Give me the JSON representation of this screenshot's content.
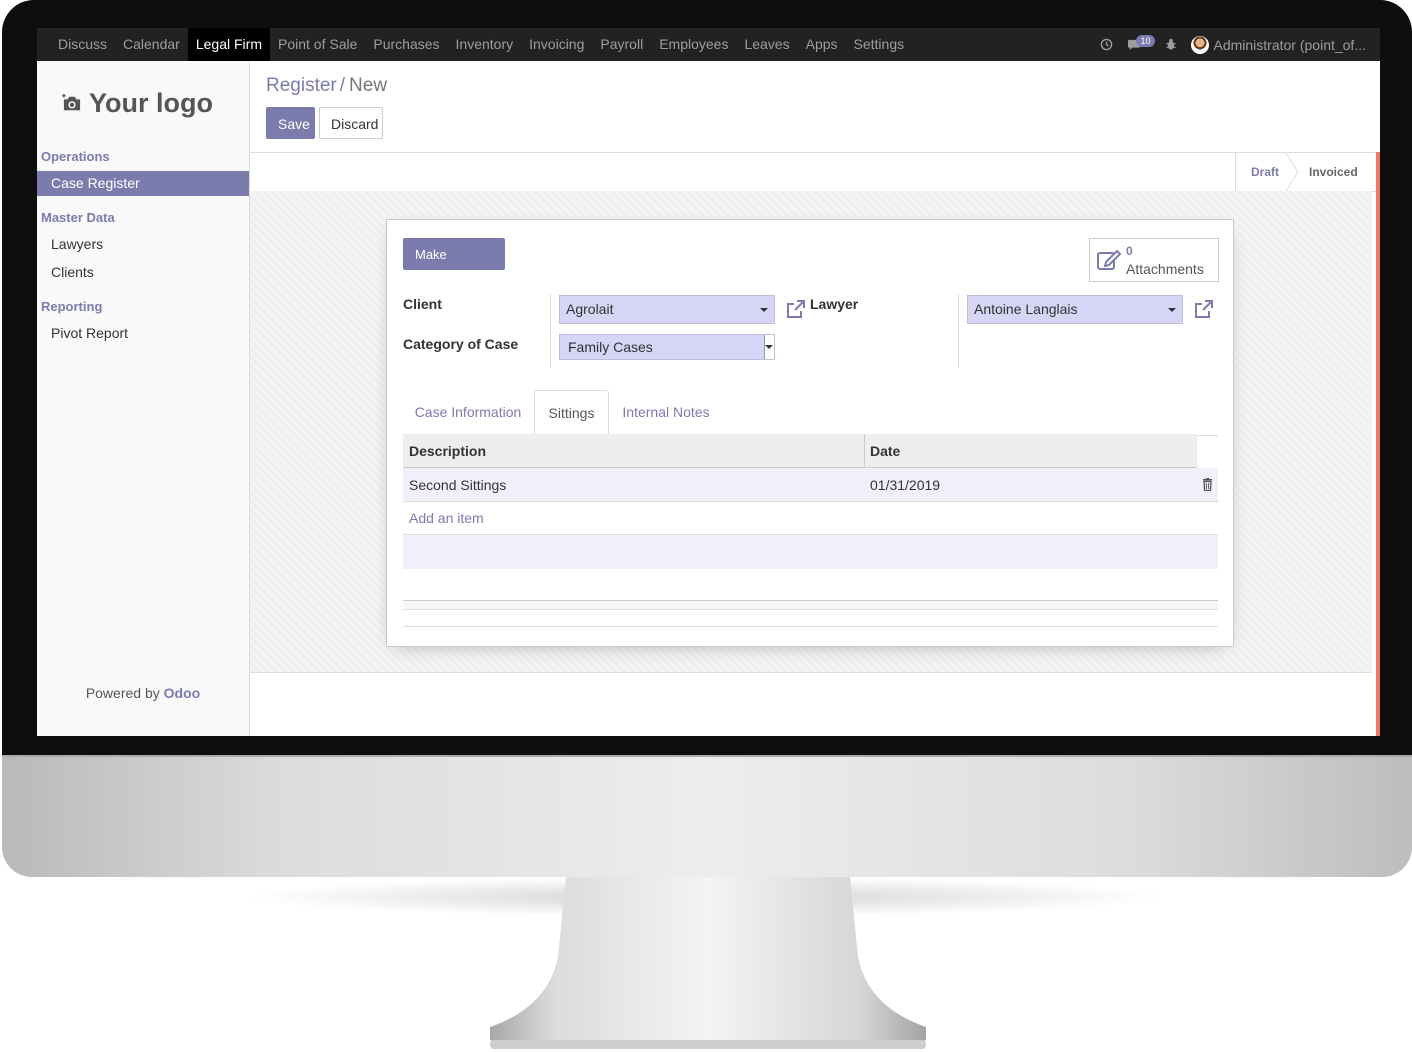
{
  "topbar": {
    "menu": [
      "Discuss",
      "Calendar",
      "Legal Firm",
      "Point of Sale",
      "Purchases",
      "Inventory",
      "Invoicing",
      "Payroll",
      "Employees",
      "Leaves",
      "Apps",
      "Settings"
    ],
    "active_index": 2,
    "messages_count": "10",
    "user_name": "Administrator (point_of..."
  },
  "sidebar": {
    "logo_text": "Your logo",
    "sections": [
      {
        "title": "Operations",
        "items": [
          "Case Register"
        ]
      },
      {
        "title": "Master Data",
        "items": [
          "Lawyers",
          "Clients"
        ]
      },
      {
        "title": "Reporting",
        "items": [
          "Pivot Report"
        ]
      }
    ],
    "powered_prefix": "Powered by",
    "powered_brand": "Odoo"
  },
  "control": {
    "breadcrumb_parent": "Register",
    "breadcrumb_sep": "/",
    "breadcrumb_current": "New",
    "save_label": "Save",
    "discard_label": "Discard"
  },
  "statusbar": {
    "stages": [
      "Draft",
      "Invoiced"
    ]
  },
  "form": {
    "make_payment_label": "Make Payment",
    "attachments_count": "0",
    "attachments_label": "Attachments",
    "client_label": "Client",
    "client_value": "Agrolait",
    "category_label": "Category of Case",
    "category_value": "Family Cases",
    "lawyer_label": "Lawyer",
    "lawyer_value": "Antoine Langlais"
  },
  "tabs": [
    "Case Information",
    "Sittings",
    "Internal Notes"
  ],
  "active_tab": 1,
  "sittings": {
    "columns": [
      "Description",
      "Date"
    ],
    "rows": [
      {
        "description": "Second Sittings",
        "date": "01/31/2019"
      }
    ],
    "add_item_label": "Add an item"
  },
  "colors": {
    "accent": "#7c7bad",
    "topbar": "#222222",
    "status_accent": "#f0786a"
  }
}
